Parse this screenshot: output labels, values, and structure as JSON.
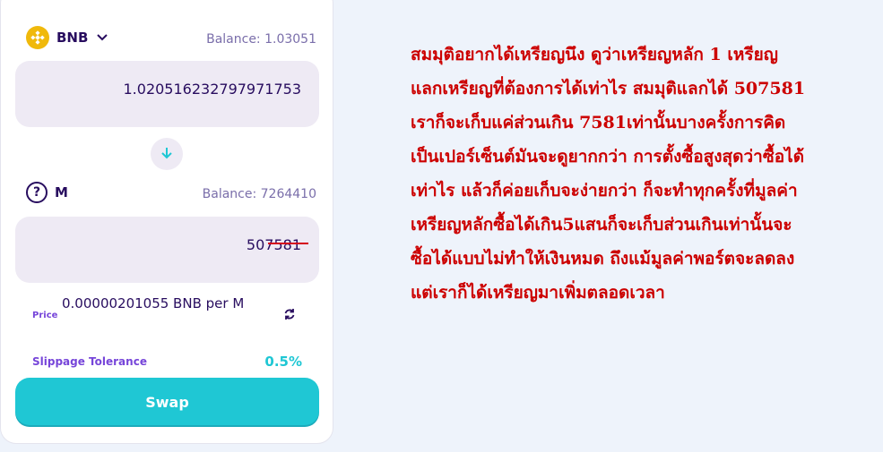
{
  "from": {
    "symbol": "BNB",
    "balance": "Balance: 1.03051",
    "amount": "1.020516232797971753",
    "icon": "bnb-icon"
  },
  "to": {
    "symbol": "M",
    "balance": "Balance: 7264410",
    "amount": "507581",
    "icon": "question-icon"
  },
  "price": {
    "label": "Price",
    "value": "0.00000201055 BNB per M"
  },
  "slippage": {
    "label": "Slippage Tolerance",
    "value": "0.5%"
  },
  "swap_label": "Swap",
  "colors": {
    "accent": "#1fc7d4",
    "text_primary": "#280d5f",
    "annotation_red": "#cc0000"
  },
  "note_lines": [
    "สมมุติอยากได้เหรียญนึง ดูว่าเหรียญหลัก 1 เหรียญ",
    "แลกเหรียญที่ต้องการได้เท่าไร สมมุติแลกได้ 507581",
    "เราก็จะเก็บแค่ส่วนเกิน 7581เท่านั้นบางครั้งการคิด",
    "เป็นเปอร์เซ็นต์มันจะดูยากกว่า การตั้งซื้อสูงสุดว่าซื้อได้",
    "เท่าไร แล้วก็ค่อยเก็บจะง่ายกว่า ก็จะทำทุกครั้งที่มูลค่า",
    "เหรียญหลักซื้อได้เกิน5แสนก็จะเก็บส่วนเกินเท่านั้นจะ",
    "ซื้อได้แบบไม่ทำให้เงินหมด ถึงแม้มูลค่าพอร์ตจะลดลง",
    "แต่เราก็ได้เหรียญมาเพิ่มตลอดเวลา"
  ]
}
